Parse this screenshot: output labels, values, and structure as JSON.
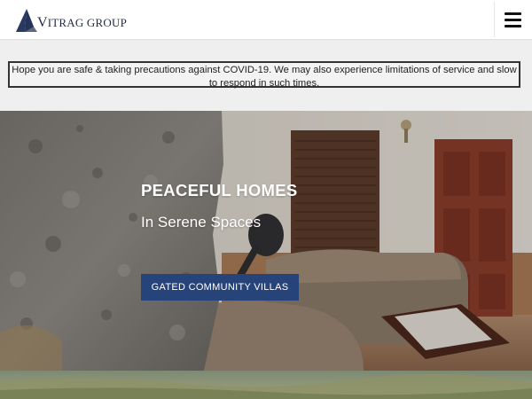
{
  "header": {
    "logo_text_initial": "V",
    "logo_text_rest": "ITRAG GROUP",
    "logo_icon": "vitrag-group-logo-mark",
    "menu_icon": "hamburger-menu-icon"
  },
  "notice": {
    "text": "Hope you are safe & taking precautions against COVID-19. We may also experience limitations of service and slow to respond in such times."
  },
  "hero": {
    "title": "PEACEFUL HOMES",
    "subtitle": "In Serene Spaces",
    "cta_label": "GATED COMMUNITY VILLAS"
  },
  "colors": {
    "brand_navy": "#1f2a44",
    "cta_background": "#26437a",
    "page_background": "#efefef",
    "notice_border": "#333333"
  }
}
